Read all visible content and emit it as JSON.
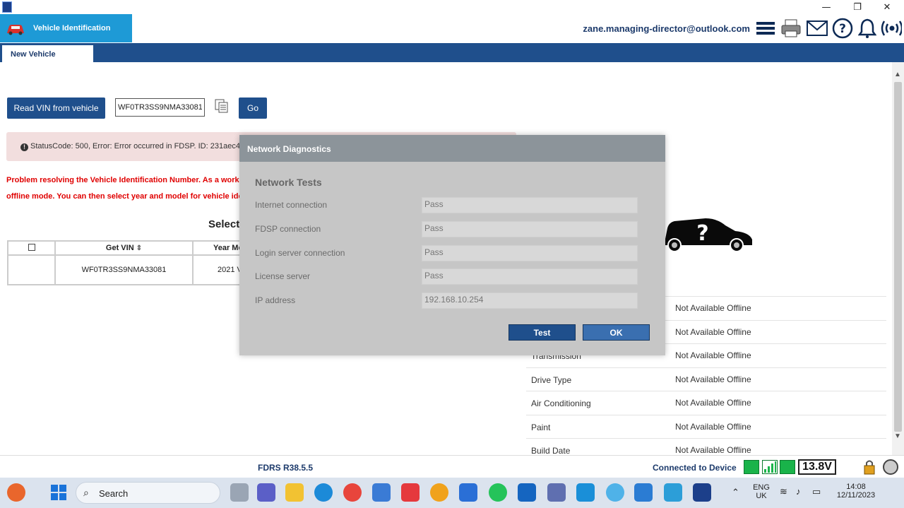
{
  "window": {
    "minimize": "—",
    "restore": "❐",
    "close": "✕"
  },
  "header": {
    "module_label": "Vehicle Identification",
    "user_email": "zane.managing-director@outlook.com",
    "icons": [
      "menu-icon",
      "printer-icon",
      "mail-icon",
      "help-icon",
      "bell-icon",
      "wireless-icon"
    ]
  },
  "tabs": [
    {
      "label": "New Vehicle"
    }
  ],
  "vin_section": {
    "read_button": "Read VIN from vehicle",
    "vin_value": "WF0TR3SS9NMA33081",
    "go_button": "Go"
  },
  "error": {
    "icon": "!",
    "text": "StatusCode: 500, Error: Error occurred in FDSP. ID: 231aec4"
  },
  "problem_text": {
    "line1": "Problem resolving the Vehicle Identification Number. As a worka",
    "line2": "offline mode. You can then select year and model for vehicle ide"
  },
  "select_heading": "Select",
  "vin_table": {
    "columns": [
      "",
      "Get VIN",
      "Year Mo"
    ],
    "rows": [
      {
        "vin": "WF0TR3SS9NMA33081",
        "year": "2021 V"
      }
    ]
  },
  "vehicle_props": [
    {
      "label": "",
      "value": "Not Available Offline"
    },
    {
      "label": "",
      "value": "Not Available Offline"
    },
    {
      "label": "Transmission",
      "value": "Not Available Offline"
    },
    {
      "label": "Drive Type",
      "value": "Not Available Offline"
    },
    {
      "label": "Air Conditioning",
      "value": "Not Available Offline"
    },
    {
      "label": "Paint",
      "value": "Not Available Offline"
    },
    {
      "label": "Build Date",
      "value": "Not Available Offline"
    }
  ],
  "dialog": {
    "title": "Network Diagnostics",
    "section": "Network Tests",
    "tests": [
      {
        "label": "Internet connection",
        "value": "Pass"
      },
      {
        "label": "FDSP connection",
        "value": "Pass"
      },
      {
        "label": "Login server connection",
        "value": "Pass"
      },
      {
        "label": "License server",
        "value": "Pass"
      },
      {
        "label": "IP address",
        "value": "192.168.10.254"
      }
    ],
    "test_button": "Test",
    "ok_button": "OK"
  },
  "statusbar": {
    "version": "FDRS R38.5.5",
    "connection": "Connected to Device",
    "voltage": "13.8V"
  },
  "taskbar": {
    "search_label": "Search",
    "lang1": "ENG",
    "lang2": "UK",
    "time": "14:08",
    "date": "12/11/2023"
  },
  "colors": {
    "accent": "#1f4f8c",
    "module_tab": "#1e9ad6",
    "error_bg": "#f2dede",
    "error_text": "#e00000",
    "connected_green": "#19b34a"
  }
}
